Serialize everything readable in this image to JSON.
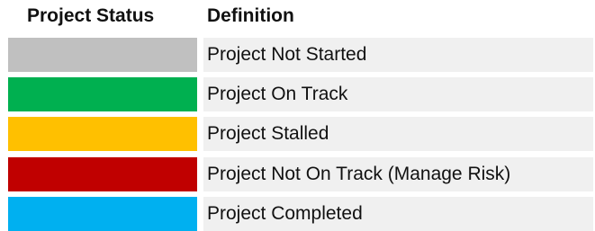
{
  "header": {
    "status_label": "Project Status",
    "definition_label": "Definition"
  },
  "rows": [
    {
      "definition": "Project Not Started",
      "color": "#c0c0c0"
    },
    {
      "definition": "Project On Track",
      "color": "#00b050"
    },
    {
      "definition": "Project Stalled",
      "color": "#ffc000"
    },
    {
      "definition": "Project Not On Track (Manage Risk)",
      "color": "#c00000"
    },
    {
      "definition": "Project Completed",
      "color": "#00b0f0"
    }
  ]
}
